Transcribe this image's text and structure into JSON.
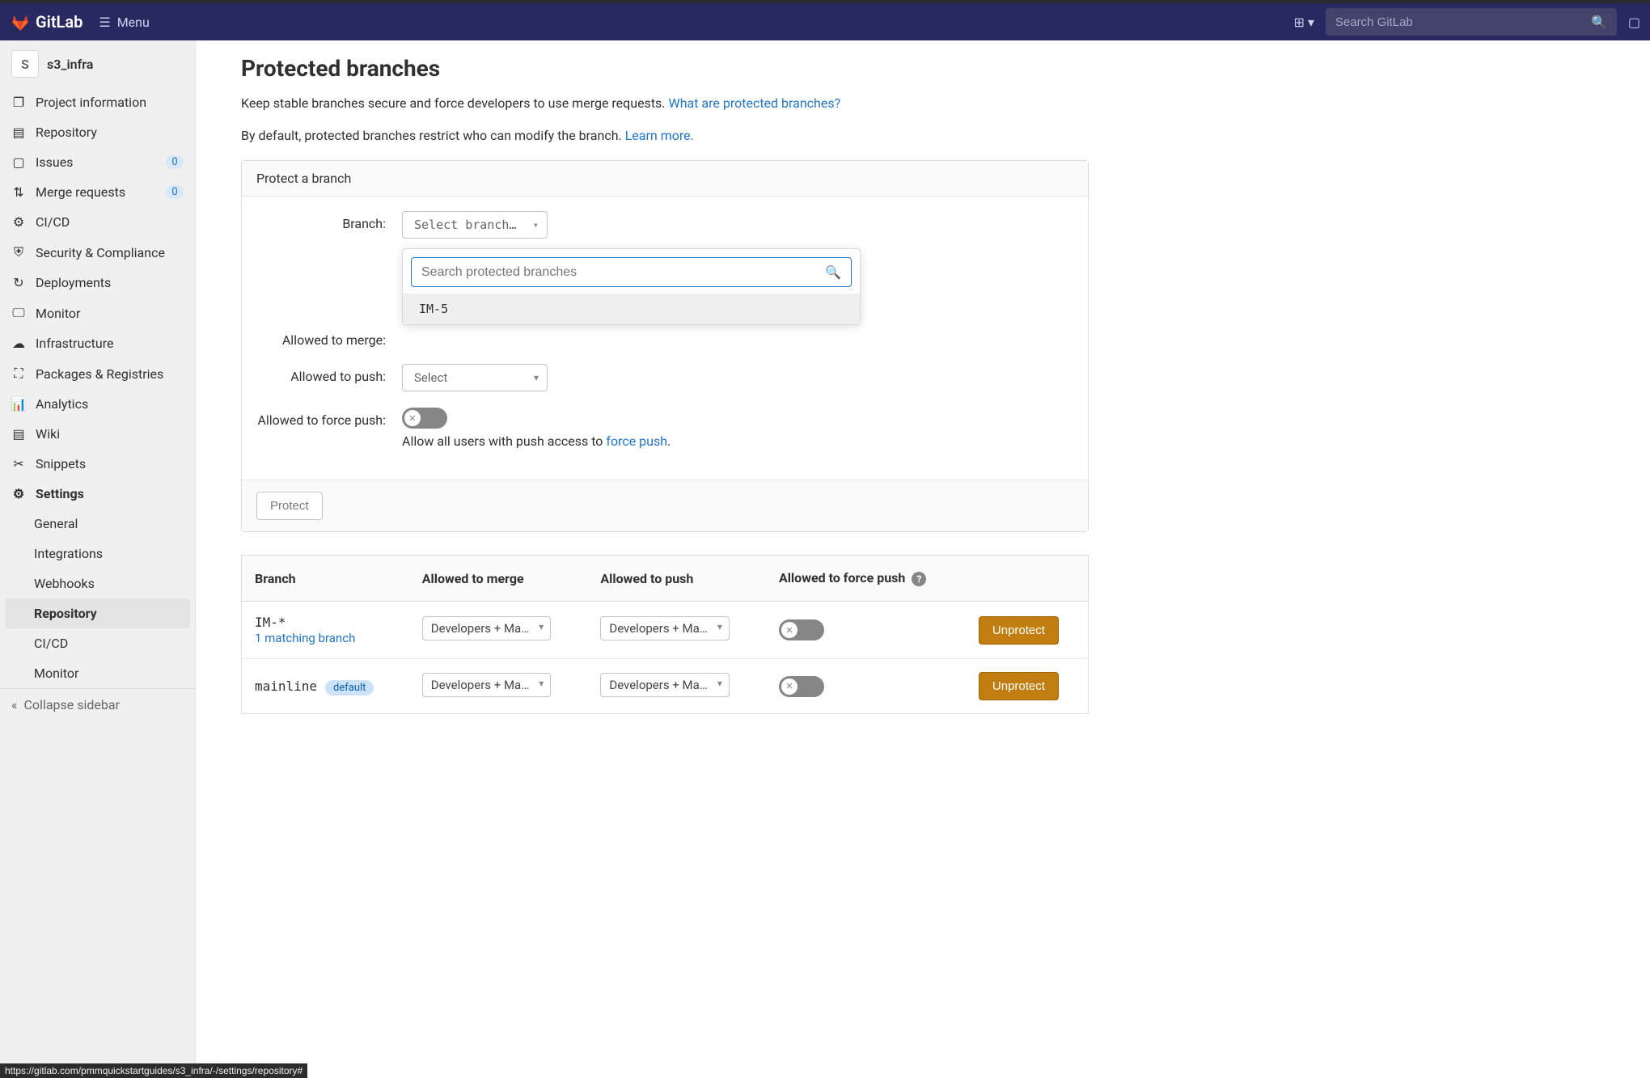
{
  "topbar": {
    "app": "GitLab",
    "menu": "Menu",
    "search_placeholder": "Search GitLab"
  },
  "project": {
    "initial": "S",
    "name": "s3_infra"
  },
  "sidebar": {
    "items": [
      {
        "icon": "project",
        "label": "Project information"
      },
      {
        "icon": "repo",
        "label": "Repository"
      },
      {
        "icon": "issues",
        "label": "Issues",
        "badge": "0"
      },
      {
        "icon": "mr",
        "label": "Merge requests",
        "badge": "0"
      },
      {
        "icon": "cicd",
        "label": "CI/CD"
      },
      {
        "icon": "security",
        "label": "Security & Compliance"
      },
      {
        "icon": "deploy",
        "label": "Deployments"
      },
      {
        "icon": "monitor",
        "label": "Monitor"
      },
      {
        "icon": "infra",
        "label": "Infrastructure"
      },
      {
        "icon": "packages",
        "label": "Packages & Registries"
      },
      {
        "icon": "analytics",
        "label": "Analytics"
      },
      {
        "icon": "wiki",
        "label": "Wiki"
      },
      {
        "icon": "snippets",
        "label": "Snippets"
      },
      {
        "icon": "settings",
        "label": "Settings"
      }
    ],
    "settings_children": [
      {
        "label": "General"
      },
      {
        "label": "Integrations"
      },
      {
        "label": "Webhooks"
      },
      {
        "label": "Repository",
        "active": true
      },
      {
        "label": "CI/CD"
      },
      {
        "label": "Monitor"
      }
    ],
    "collapse": "Collapse sidebar"
  },
  "page": {
    "title": "Protected branches",
    "desc1": "Keep stable branches secure and force developers to use merge requests. ",
    "desc1_link": "What are protected branches?",
    "desc2": "By default, protected branches restrict who can modify the branch. ",
    "desc2_link": "Learn more."
  },
  "form": {
    "card_title": "Protect a branch",
    "branch_label": "Branch:",
    "branch_select": "Select branch…",
    "dd_search_placeholder": "Search protected branches",
    "dd_opt": "IM-5",
    "merge_label": "Allowed to merge:",
    "push_label": "Allowed to push:",
    "push_select": "Select",
    "force_label": "Allowed to force push:",
    "force_desc1": "Allow all users with push access to ",
    "force_link": "force push",
    "force_desc2": ".",
    "protect_btn": "Protect"
  },
  "table": {
    "headers": {
      "branch": "Branch",
      "merge": "Allowed to merge",
      "push": "Allowed to push",
      "force": "Allowed to force push"
    },
    "rows": [
      {
        "branch": "IM-*",
        "match": "1 matching branch",
        "merge": "Developers + Ma…",
        "push": "Developers + Ma…",
        "unprotect": "Unprotect"
      },
      {
        "branch": "mainline",
        "default": "default",
        "merge": "Developers + Ma…",
        "push": "Developers + Ma…",
        "unprotect": "Unprotect"
      }
    ]
  },
  "status_url": "https://gitlab.com/pmmquickstartguides/s3_infra/-/settings/repository#"
}
